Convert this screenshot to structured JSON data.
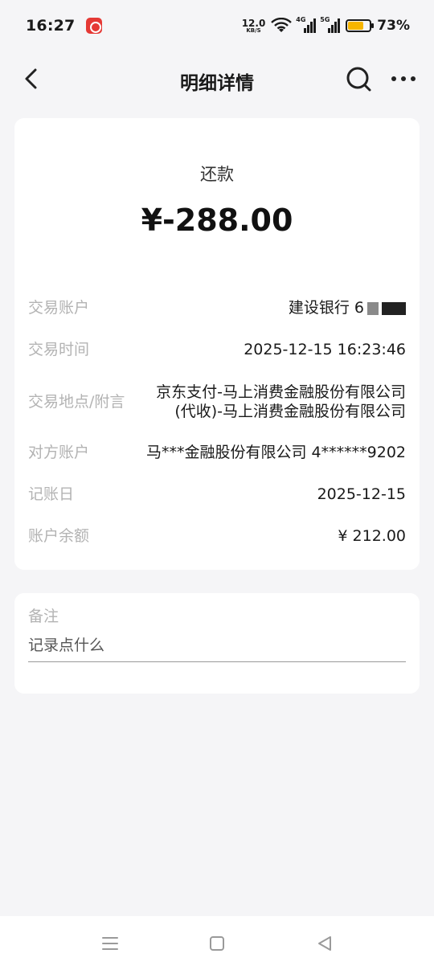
{
  "status_bar": {
    "time": "16:27",
    "net_speed_value": "12.0",
    "net_speed_unit": "KB/S",
    "signal1_tag": "4G",
    "signal2_tag": "5G",
    "battery_level": 0.73,
    "battery_percent": "73%",
    "battery_color": "#f7b500"
  },
  "nav": {
    "title": "明细详情",
    "back_icon": "chevron-left-icon",
    "search_icon": "search-icon",
    "more_icon": "more-horizontal-icon"
  },
  "transaction": {
    "type": "还款",
    "amount": "¥-288.00",
    "details": [
      {
        "label": "交易账户",
        "value": "建设银行 6"
      },
      {
        "label": "交易时间",
        "value": "2025-12-15 16:23:46"
      },
      {
        "label": "交易地点/附言",
        "value_line1": "京东支付-马上消费金融股份有限公司",
        "value_line2": "(代收)-马上消费金融股份有限公司"
      },
      {
        "label": "对方账户",
        "value": "马***金融股份有限公司 4******9202"
      },
      {
        "label": "记账日",
        "value": "2025-12-15"
      },
      {
        "label": "账户余额",
        "value": "¥ 212.00"
      }
    ]
  },
  "note": {
    "label": "备注",
    "placeholder": "记录点什么"
  },
  "system_nav": {
    "menu_icon": "menu-icon",
    "home_icon": "square-home-icon",
    "back_icon": "triangle-back-icon"
  }
}
